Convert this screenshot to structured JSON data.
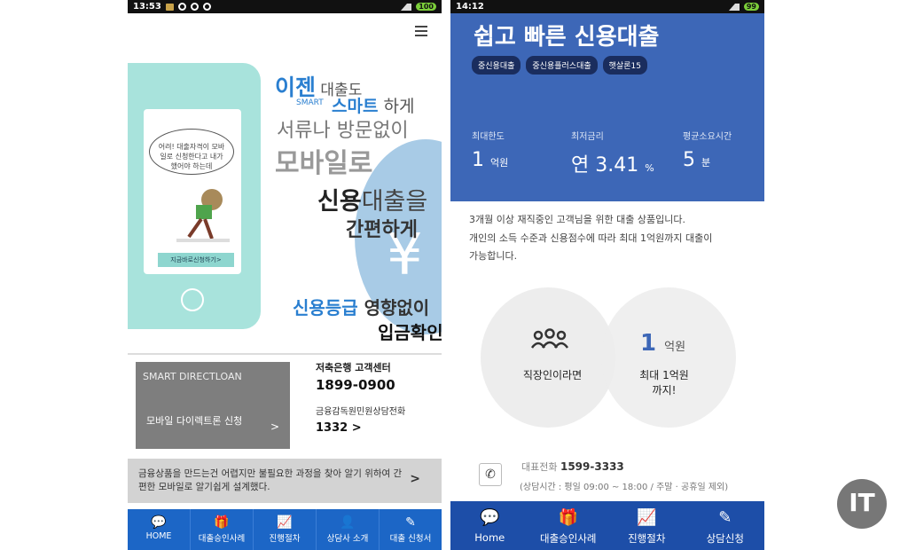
{
  "left": {
    "status": {
      "time": "13:53",
      "battery": "100"
    },
    "hero": {
      "l1a": "이젠",
      "l1b": " 대출도",
      "smart": "SMART",
      "l2a": "스마트",
      "l2b": " 하게",
      "l3": "서류나 방문없이",
      "l4": "모바일로",
      "l5a": "신용",
      "l5b": "대출을",
      "l6": "간편하게",
      "l7a": "신용등급",
      "l7b": " 영향없이",
      "l8": "입금확인",
      "bubble": "어려! 대출자격이 모바일로 신청한다고 내가 했어야 하는데",
      "screen_btn": "지금바로신청하기>",
      "yen": "¥"
    },
    "direct": {
      "title": "SMART DIRECTLOAN",
      "label": "모바일 다이렉트론 신청",
      "arrow": ">"
    },
    "cs": {
      "label1": "저축은행 고객센터",
      "phone1": "1899-0900",
      "label2": "금융감독원민원상담전화",
      "phone2": "1332 >"
    },
    "notice": {
      "text": "금융상품을 만드는건 어렵지만 불필요한 과정을 찾아 알기 위하여 간편한 모바일로 알기쉽게  설계했다.",
      "arrow": ">"
    },
    "nav": [
      {
        "icon": "💬",
        "label": "HOME"
      },
      {
        "icon": "🎁",
        "label": "대출승인사례"
      },
      {
        "icon": "📈",
        "label": "진행절차"
      },
      {
        "icon": "👤",
        "label": "상담사 소개"
      },
      {
        "icon": "✎",
        "label": "대출 신청서"
      }
    ]
  },
  "right": {
    "status": {
      "time": "14:12",
      "battery": "99"
    },
    "title": "쉽고 빠른 신용대출",
    "tags": [
      "중신용대출",
      "중신용플러스대출",
      "햇살론15"
    ],
    "stats": [
      {
        "label": "최대한도",
        "value": "1",
        "unit": "억원"
      },
      {
        "label": "최저금리",
        "value": "연 3.41",
        "unit": "%"
      },
      {
        "label": "평균소요시간",
        "value": "5",
        "unit": "분"
      }
    ],
    "description": [
      "3개월 이상 재직중인 고객님을 위한 대출 상품입니다.",
      "개인의 소득 수준과 신용점수에 따라 최대 1억원까지 대출이",
      "가능합니다."
    ],
    "circle1": {
      "label": "직장인이라면"
    },
    "circle2": {
      "big": "1",
      "unit": "억원",
      "label1": "최대 1억원",
      "label2": "까지!"
    },
    "contact": {
      "label": "대표전화",
      "phone": "1599-3333",
      "hours": "(상담시간 : 평일 09:00 ~ 18:00 / 주말 · 공휴일 제외)"
    },
    "nav": [
      {
        "icon": "💬",
        "label": "Home"
      },
      {
        "icon": "🎁",
        "label": "대출승인사례"
      },
      {
        "icon": "📈",
        "label": "진행절차"
      },
      {
        "icon": "✎",
        "label": "상담신청"
      }
    ]
  },
  "logo": {
    "text": "IT"
  }
}
